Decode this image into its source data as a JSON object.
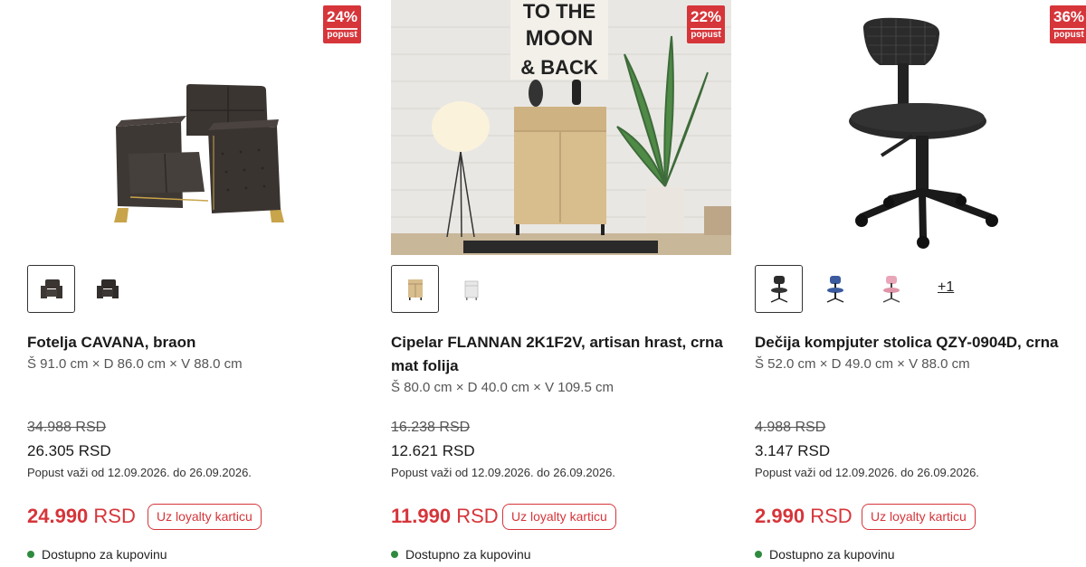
{
  "colors": {
    "accent": "#d6353a",
    "available": "#2e8b3e"
  },
  "products": [
    {
      "badge_pct": "24%",
      "badge_label": "popust",
      "thumbs_more": "",
      "title": "Fotelja CAVANA, braon",
      "dims": "Š 91.0 cm × D 86.0 cm × V 88.0 cm",
      "old_price": "34.988 RSD",
      "new_price": "26.305 RSD",
      "promo_note": "Popust važi od 12.09.2026. do 26.09.2026.",
      "loyalty_amount": "24.990",
      "loyalty_currency": "RSD",
      "loyalty_button": "Uz loyalty karticu",
      "availability": "Dostupno za kupovinu",
      "thumb_icons": [
        "armchair-dark-icon",
        "armchair-dark-icon"
      ]
    },
    {
      "badge_pct": "22%",
      "badge_label": "popust",
      "thumbs_more": "",
      "poster_lines": [
        "TO THE",
        "MOON",
        "& BACK"
      ],
      "title": "Cipelar FLANNAN 2K1F2V, artisan hrast, crna mat folija",
      "dims": "Š 80.0 cm × D 40.0 cm × V 109.5 cm",
      "old_price": "16.238 RSD",
      "new_price": "12.621 RSD",
      "promo_note": "Popust važi od 12.09.2026. do 26.09.2026.",
      "loyalty_amount": "11.990",
      "loyalty_currency": "RSD",
      "loyalty_button": "Uz loyalty karticu",
      "availability": "Dostupno za kupovinu",
      "thumb_icons": [
        "cabinet-oak-icon",
        "cabinet-white-icon"
      ]
    },
    {
      "badge_pct": "36%",
      "badge_label": "popust",
      "thumbs_more": "+1",
      "title": "Dečija kompjuter stolica QZY-0904D, crna",
      "dims": "Š 52.0 cm × D 49.0 cm × V 88.0 cm",
      "old_price": "4.988 RSD",
      "new_price": "3.147 RSD",
      "promo_note": "Popust važi od 12.09.2026. do 26.09.2026.",
      "loyalty_amount": "2.990",
      "loyalty_currency": "RSD",
      "loyalty_button": "Uz loyalty karticu",
      "availability": "Dostupno za kupovinu",
      "thumb_icons": [
        "office-chair-black-icon",
        "office-chair-blue-icon",
        "office-chair-pink-icon"
      ]
    }
  ]
}
